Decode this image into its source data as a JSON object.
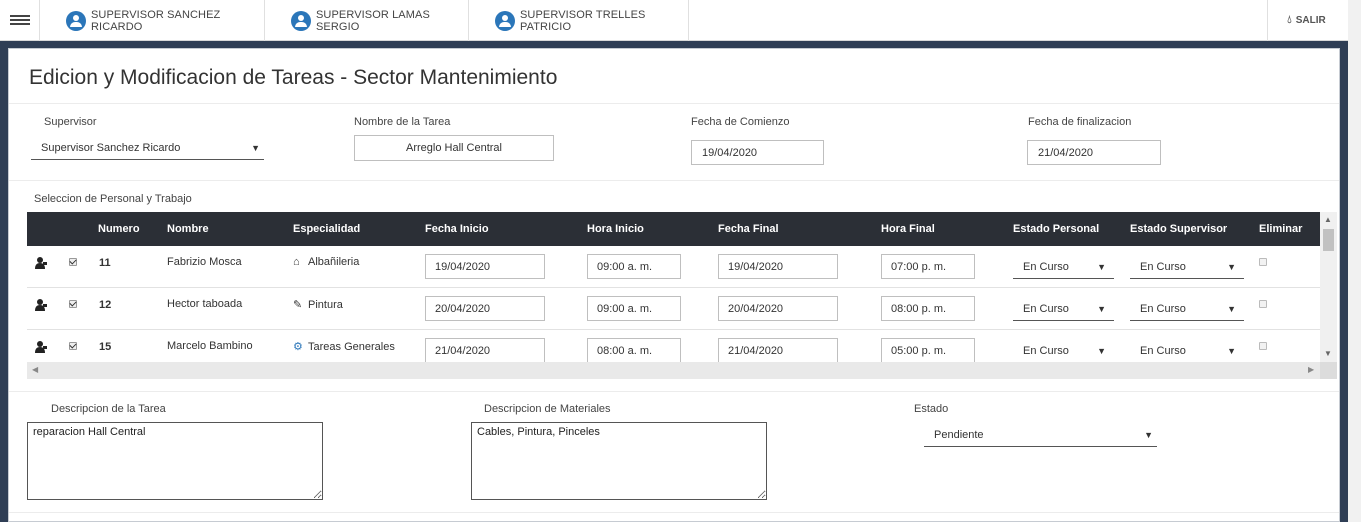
{
  "nav": {
    "tabs": [
      {
        "label": "SUPERVISOR SANCHEZ RICARDO"
      },
      {
        "label": "SUPERVISOR LAMAS SERGIO"
      },
      {
        "label": "SUPERVISOR TRELLES PATRICIO"
      }
    ],
    "exit_label": "SALIR"
  },
  "page": {
    "title": "Edicion y Modificacion de Tareas - Sector Mantenimiento"
  },
  "form": {
    "supervisor_label": "Supervisor",
    "supervisor_value": "Supervisor Sanchez Ricardo",
    "task_name_label": "Nombre de la Tarea",
    "task_name_value": "Arreglo Hall Central",
    "start_date_label": "Fecha de Comienzo",
    "start_date_value": "19/04/2020",
    "end_date_label": "Fecha de finalizacion",
    "end_date_value": "21/04/2020"
  },
  "personnel": {
    "section_label": "Seleccion de Personal y Trabajo",
    "columns": [
      "Numero",
      "Nombre",
      "Especialidad",
      "Fecha Inicio",
      "Hora Inicio",
      "Fecha Final",
      "Hora Final",
      "Estado Personal",
      "Estado Supervisor",
      "Eliminar"
    ],
    "rows": [
      {
        "numero": "11",
        "nombre": "Fabrizio Mosca",
        "especialidad": "Albañileria",
        "spec_icon": "trowel-icon",
        "fecha_inicio": "19/04/2020",
        "hora_inicio": "09:00 a. m.",
        "fecha_final": "19/04/2020",
        "hora_final": "07:00 p. m.",
        "estado_personal": "En Curso",
        "estado_supervisor": "En Curso",
        "selected": true
      },
      {
        "numero": "12",
        "nombre": "Hector taboada",
        "especialidad": "Pintura",
        "spec_icon": "paint-roller-icon",
        "fecha_inicio": "20/04/2020",
        "hora_inicio": "09:00 a. m.",
        "fecha_final": "20/04/2020",
        "hora_final": "08:00 p. m.",
        "estado_personal": "En Curso",
        "estado_supervisor": "En Curso",
        "selected": true
      },
      {
        "numero": "15",
        "nombre": "Marcelo Bambino",
        "especialidad": "Tareas Generales",
        "spec_icon": "tools-icon",
        "fecha_inicio": "21/04/2020",
        "hora_inicio": "08:00 a. m.",
        "fecha_final": "21/04/2020",
        "hora_final": "05:00 p. m.",
        "estado_personal": "En Curso",
        "estado_supervisor": "En Curso",
        "selected": true
      }
    ]
  },
  "details": {
    "task_desc_label": "Descripcion de la Tarea",
    "task_desc_value": "reparacion Hall Central",
    "materials_label": "Descripcion de Materiales",
    "materials_value": "Cables, Pintura, Pinceles",
    "state_label": "Estado",
    "state_value": "Pendiente"
  },
  "colors": {
    "frame": "#2f3e55",
    "table_header": "#2b2f36",
    "avatar": "#2b76b9"
  }
}
